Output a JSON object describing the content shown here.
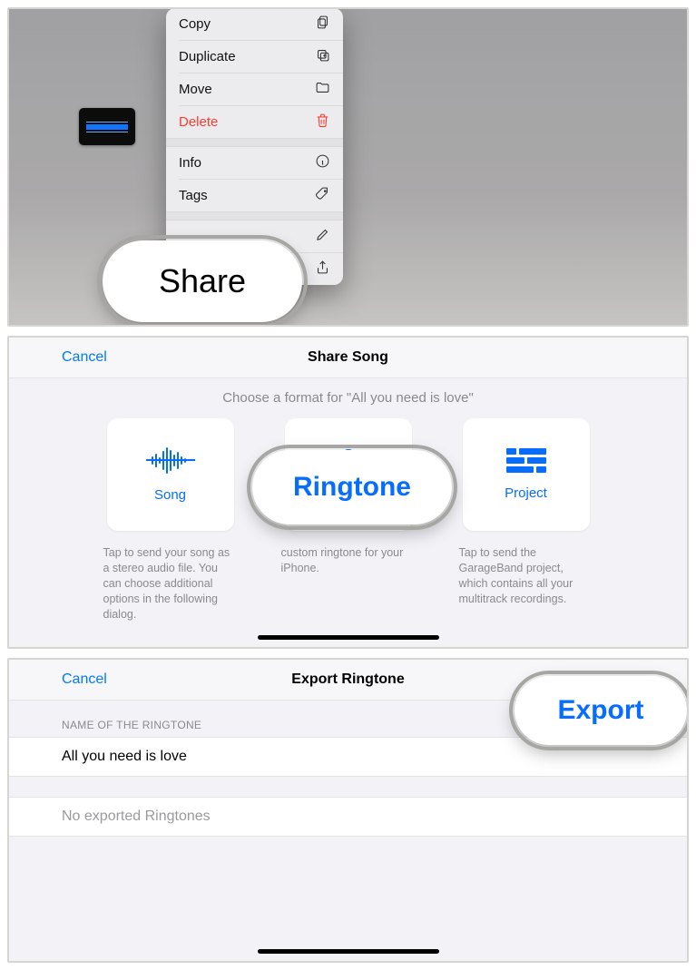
{
  "contextMenu": {
    "items": [
      {
        "label": "Copy",
        "icon": "copy-icon",
        "destructive": false
      },
      {
        "label": "Duplicate",
        "icon": "duplicate-icon",
        "destructive": false
      },
      {
        "label": "Move",
        "icon": "folder-icon",
        "destructive": false
      },
      {
        "label": "Delete",
        "icon": "trash-icon",
        "destructive": true
      },
      {
        "label": "Info",
        "icon": "info-icon",
        "destructive": false
      },
      {
        "label": "Tags",
        "icon": "tag-icon",
        "destructive": false
      },
      {
        "label": "",
        "icon": "pencil-icon",
        "destructive": false
      },
      {
        "label": "",
        "icon": "share-icon",
        "destructive": false
      }
    ]
  },
  "callouts": {
    "share": "Share",
    "ringtone": "Ringtone",
    "export": "Export"
  },
  "shareSong": {
    "cancel": "Cancel",
    "title": "Share Song",
    "chooseLine": "Choose a format for \"All you need is love\"",
    "cards": {
      "song": {
        "label": "Song",
        "desc": "Tap to send your song as a stereo audio file. You can choose additional options in the following dialog."
      },
      "ringtone": {
        "label": "Ringtone",
        "desc": "custom ringtone for your iPhone."
      },
      "project": {
        "label": "Project",
        "desc": "Tap to send the GarageBand project, which contains all your multitrack recordings."
      }
    }
  },
  "exportRingtone": {
    "cancel": "Cancel",
    "title": "Export Ringtone",
    "sectionLabel": "NAME OF THE RINGTONE",
    "name": "All you need is love",
    "emptyState": "No exported Ringtones"
  },
  "colors": {
    "blue": "#007aff",
    "brightBlue": "#066dff",
    "red": "#ff3b30"
  }
}
